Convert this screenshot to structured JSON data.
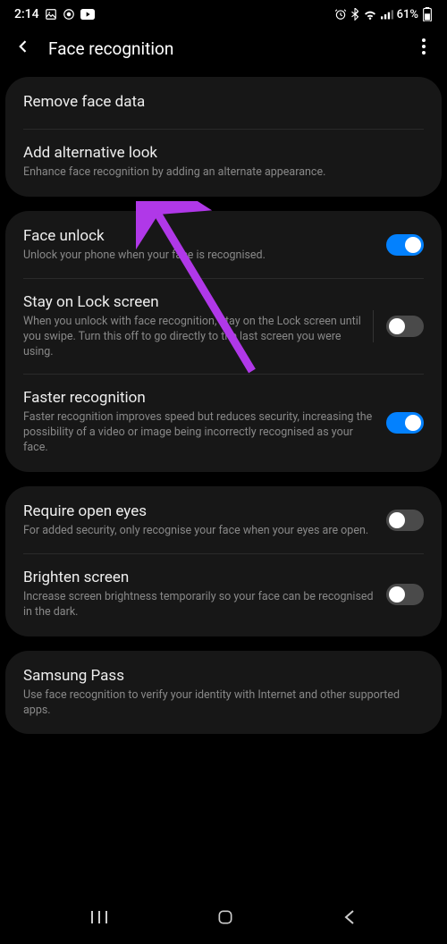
{
  "status_bar": {
    "time": "2:14",
    "battery_pct": "61%"
  },
  "header": {
    "title": "Face recognition"
  },
  "sections": [
    {
      "rows": [
        {
          "title": "Remove face data"
        },
        {
          "title": "Add alternative look",
          "desc": "Enhance face recognition by adding an alternate appearance."
        }
      ]
    },
    {
      "rows": [
        {
          "title": "Face unlock",
          "desc": "Unlock your phone when your face is recognised.",
          "toggle": true,
          "divider_before_toggle": false
        },
        {
          "title": "Stay on Lock screen",
          "desc": "When you unlock with face recognition, stay on the Lock screen until you swipe. Turn this off to go directly to the last screen you were using.",
          "toggle": false,
          "divider_before_toggle": true
        },
        {
          "title": "Faster recognition",
          "desc": "Faster recognition improves speed but reduces security, increasing the possibility of a video or image being incorrectly recognised as your face.",
          "toggle": true,
          "divider_before_toggle": false
        }
      ]
    },
    {
      "rows": [
        {
          "title": "Require open eyes",
          "desc": "For added security, only recognise your face when your eyes are open.",
          "toggle": false
        },
        {
          "title": "Brighten screen",
          "desc": "Increase screen brightness temporarily so your face can be recognised in the dark.",
          "toggle": false
        }
      ]
    },
    {
      "rows": [
        {
          "title": "Samsung Pass",
          "desc": "Use face recognition to verify your identity with Internet and other supported apps."
        }
      ]
    }
  ],
  "annotation": {
    "color": "#b038e8"
  }
}
